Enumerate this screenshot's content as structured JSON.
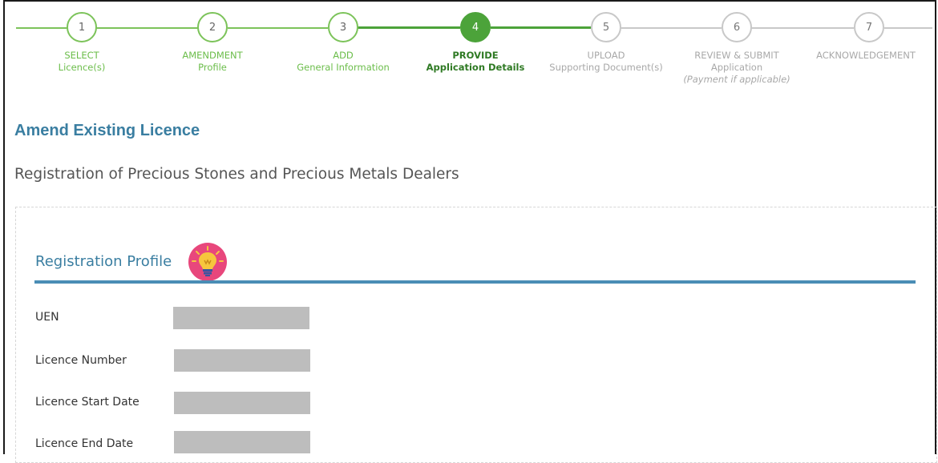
{
  "stepper": {
    "steps": [
      {
        "number": "1",
        "line1": "SELECT",
        "line2": "Licence(s)",
        "line3": ""
      },
      {
        "number": "2",
        "line1": "AMENDMENT",
        "line2": "Profile",
        "line3": ""
      },
      {
        "number": "3",
        "line1": "ADD",
        "line2": "General Information",
        "line3": ""
      },
      {
        "number": "4",
        "line1": "PROVIDE",
        "line2": "Application Details",
        "line3": ""
      },
      {
        "number": "5",
        "line1": "UPLOAD",
        "line2": "Supporting Document(s)",
        "line3": ""
      },
      {
        "number": "6",
        "line1": "REVIEW & SUBMIT",
        "line2": "Application",
        "line3": "(Payment if applicable)"
      },
      {
        "number": "7",
        "line1": "ACKNOWLEDGEMENT",
        "line2": "",
        "line3": ""
      }
    ],
    "current_step": 4,
    "colors": {
      "done": "#7cc35a",
      "current": "#4ca33a",
      "todo": "#c8c8c8"
    }
  },
  "page": {
    "title": "Amend Existing Licence",
    "subtitle": "Registration of Precious Stones and Precious Metals Dealers"
  },
  "profile": {
    "section_title": "Registration Profile",
    "tip_icon": "lightbulb-icon",
    "fields": [
      {
        "label": "UEN",
        "value": ""
      },
      {
        "label": "Licence Number",
        "value": ""
      },
      {
        "label": "Licence Start Date",
        "value": ""
      },
      {
        "label": "Licence End Date",
        "value": ""
      }
    ]
  }
}
